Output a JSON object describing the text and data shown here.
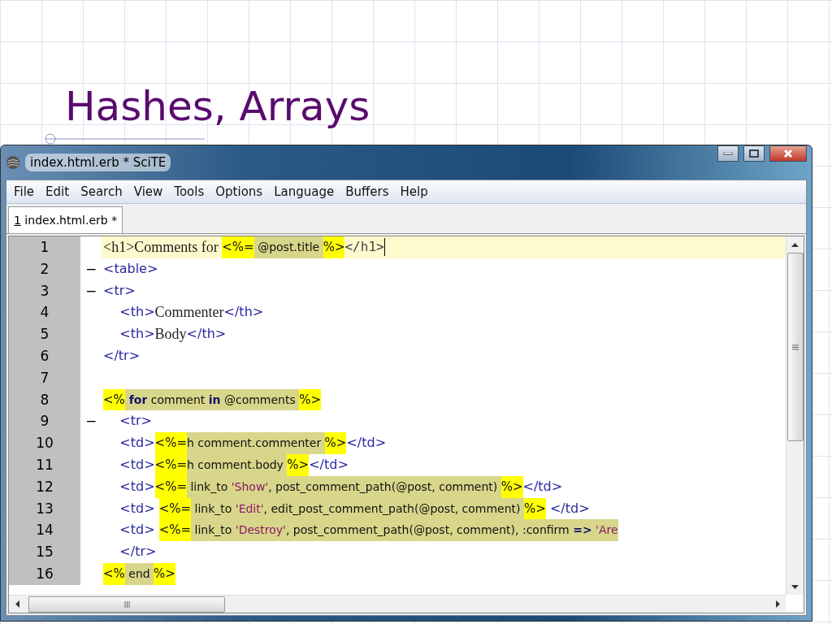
{
  "slide": {
    "title": "Hashes, Arrays"
  },
  "window": {
    "title": "index.html.erb * SciTE"
  },
  "menu": [
    "File",
    "Edit",
    "Search",
    "View",
    "Tools",
    "Options",
    "Language",
    "Buffers",
    "Help"
  ],
  "tabs": [
    {
      "number": "1",
      "label": " index.html.erb *",
      "selected": true
    }
  ],
  "lines": [
    {
      "number": "1",
      "current": true,
      "segments": [
        {
          "kind": "html",
          "text": "<h1>Comments for "
        },
        {
          "kind": "delim",
          "text": "<%="
        },
        {
          "kind": "ruby",
          "text": " @post.title "
        },
        {
          "kind": "delim",
          "text": "%>"
        },
        {
          "kind": "mono",
          "text": "</h1>"
        }
      ]
    },
    {
      "number": "2",
      "fold": "−",
      "current": false,
      "segments": [
        {
          "kind": "tag",
          "text": "<table>"
        }
      ]
    },
    {
      "number": "3",
      "fold": "−",
      "current": false,
      "segments": [
        {
          "kind": "tag",
          "text": "<tr>"
        }
      ]
    },
    {
      "number": "4",
      "current": false,
      "segments": [
        {
          "kind": "tag",
          "text": "\t<th>"
        },
        {
          "kind": "html",
          "text": "Commenter"
        },
        {
          "kind": "tag",
          "text": "</th>"
        }
      ]
    },
    {
      "number": "5",
      "current": false,
      "segments": [
        {
          "kind": "tag",
          "text": "\t<th>"
        },
        {
          "kind": "html",
          "text": "Body"
        },
        {
          "kind": "tag",
          "text": "</th>"
        }
      ]
    },
    {
      "number": "6",
      "current": false,
      "segments": [
        {
          "kind": "tag",
          "text": "</tr>"
        }
      ]
    },
    {
      "number": "7",
      "current": false
    },
    {
      "number": "8",
      "current": false,
      "segments": [
        {
          "kind": "delim",
          "text": "<%"
        },
        {
          "kind": "keyword",
          "text": " for"
        },
        {
          "kind": "ruby",
          "text": " comment "
        },
        {
          "kind": "keyword",
          "text": "in"
        },
        {
          "kind": "ruby",
          "text": " @comments "
        },
        {
          "kind": "delim",
          "text": "%>"
        }
      ]
    },
    {
      "number": "9",
      "fold": "−",
      "current": false,
      "segments": [
        {
          "kind": "tag",
          "text": "\t<tr>"
        }
      ]
    },
    {
      "number": "10",
      "current": false,
      "segments": [
        {
          "kind": "tag",
          "text": "\t<td>"
        },
        {
          "kind": "delim",
          "text": "<%="
        },
        {
          "kind": "ruby",
          "text": "h comment.commenter "
        },
        {
          "kind": "delim",
          "text": "%>"
        },
        {
          "kind": "tag",
          "text": "</td>"
        }
      ]
    },
    {
      "number": "11",
      "current": false,
      "segments": [
        {
          "kind": "tag",
          "text": "\t<td>"
        },
        {
          "kind": "delim",
          "text": "<%="
        },
        {
          "kind": "ruby",
          "text": "h comment.body "
        },
        {
          "kind": "delim",
          "text": "%>"
        },
        {
          "kind": "tag",
          "text": "</td>"
        }
      ]
    },
    {
      "number": "12",
      "current": false,
      "segments": [
        {
          "kind": "tag",
          "text": "\t<td>"
        },
        {
          "kind": "delim",
          "text": "<%="
        },
        {
          "kind": "ruby",
          "text": " link_to "
        },
        {
          "kind": "string",
          "text": "'Show'"
        },
        {
          "kind": "ruby",
          "text": ", post_comment_path(@post, comment) "
        },
        {
          "kind": "delim",
          "text": "%>"
        },
        {
          "kind": "tag",
          "text": "</td>"
        }
      ]
    },
    {
      "number": "13",
      "current": false,
      "segments": [
        {
          "kind": "tag",
          "text": "\t<td> "
        },
        {
          "kind": "delim",
          "text": "<%="
        },
        {
          "kind": "ruby",
          "text": " link_to "
        },
        {
          "kind": "string",
          "text": "'Edit'"
        },
        {
          "kind": "ruby",
          "text": ", edit_post_comment_path(@post, comment) "
        },
        {
          "kind": "delim",
          "text": "%>"
        },
        {
          "kind": "tag",
          "text": " </td>"
        }
      ]
    },
    {
      "number": "14",
      "current": false,
      "segments": [
        {
          "kind": "tag",
          "text": "\t<td> "
        },
        {
          "kind": "delim",
          "text": "<%="
        },
        {
          "kind": "ruby",
          "text": " link_to "
        },
        {
          "kind": "string",
          "text": "'Destroy'"
        },
        {
          "kind": "ruby",
          "text": ", post_comment_path(@post, comment), :confirm "
        },
        {
          "kind": "keyword",
          "text": "=>"
        },
        {
          "kind": "string",
          "text": " 'Are"
        }
      ]
    },
    {
      "number": "15",
      "current": false,
      "segments": [
        {
          "kind": "tag",
          "text": "\t</tr>"
        }
      ]
    },
    {
      "number": "16",
      "current": false,
      "segments": [
        {
          "kind": "delim",
          "text": "<%"
        },
        {
          "kind": "ruby",
          "text": " end "
        },
        {
          "kind": "delim",
          "text": "%>"
        }
      ]
    }
  ]
}
